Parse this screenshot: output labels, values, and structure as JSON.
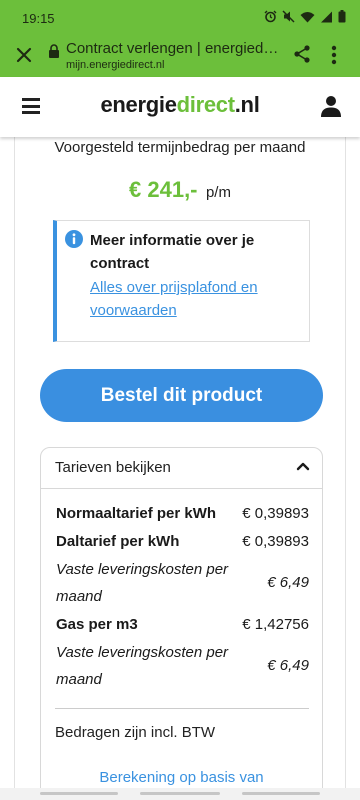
{
  "status_bar": {
    "time": "19:15",
    "icons": [
      "alarm-icon",
      "mute-icon",
      "wifi-icon",
      "signal-icon",
      "battery-icon"
    ]
  },
  "browser": {
    "title": "Contract verlengen | energiedirect.nl",
    "url": "mijn.energiedirect.nl",
    "icons": [
      "close-icon",
      "lock-icon",
      "share-icon",
      "more-vert-icon"
    ]
  },
  "site_header": {
    "logo": {
      "part1": "energie",
      "part2": "direct",
      "part3": ".nl"
    },
    "icons": [
      "hamburger-menu-icon",
      "user-account-icon"
    ]
  },
  "offer": {
    "term_label": "Voorgesteld termijnbedrag per maand",
    "price": "€ 241,-",
    "price_unit": "p/m"
  },
  "info_box": {
    "title": "Meer informatie over je contract",
    "link": "Alles over prijsplafond en voorwaarden",
    "icon": "info-icon"
  },
  "order_button": {
    "label": "Bestel dit product"
  },
  "rates": {
    "header": "Tarieven bekijken",
    "expanded": true,
    "rows": [
      {
        "label": "Normaaltarief per kWh",
        "value": "€ 0,39893",
        "style": "bold"
      },
      {
        "label": "Daltarief per kWh",
        "value": "€ 0,39893",
        "style": "bold"
      },
      {
        "label": "Vaste leveringskosten per maand",
        "value": "€ 6,49",
        "style": "italic"
      },
      {
        "label": "Gas per m3",
        "value": "€ 1,42756",
        "style": "bold"
      },
      {
        "label": "Vaste leveringskosten per maand",
        "value": "€ 6,49",
        "style": "italic"
      }
    ],
    "vat_note": "Bedragen zijn incl. BTW",
    "calc_link": "Berekening op basis van"
  },
  "colors": {
    "brand_green": "#6cbf3b",
    "link_blue": "#3a92e0",
    "button_blue": "#3a8fe0"
  }
}
